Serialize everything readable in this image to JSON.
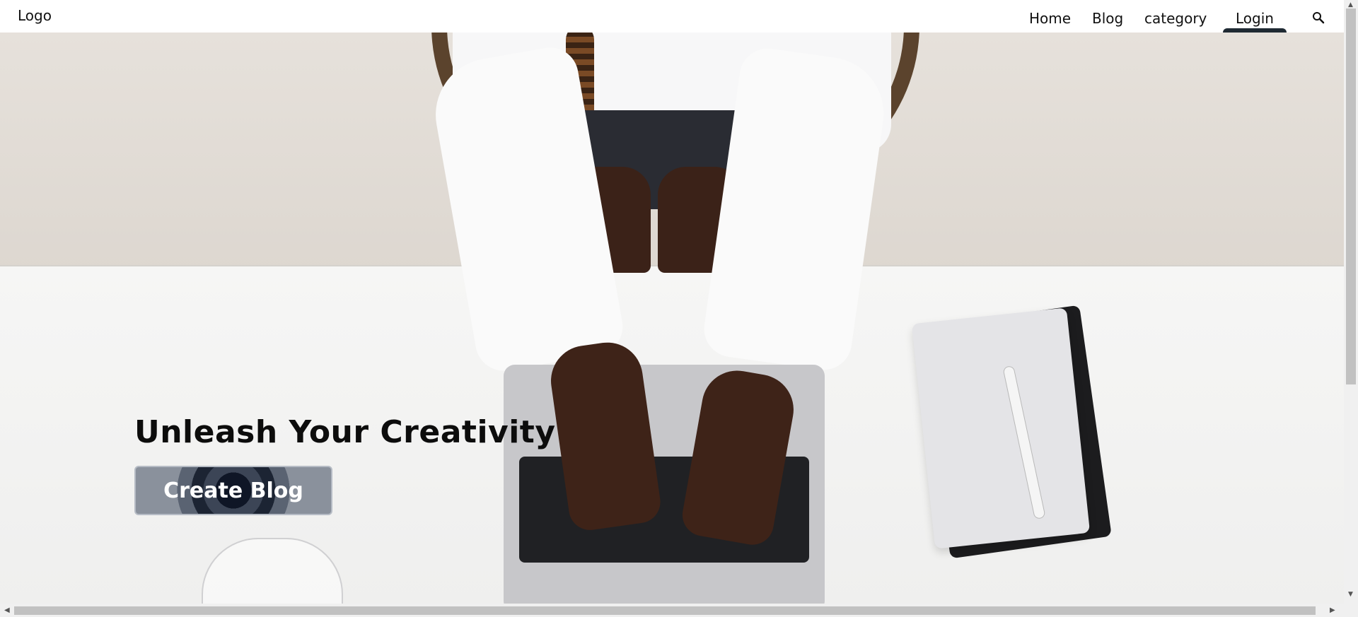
{
  "nav": {
    "logo": "Logo",
    "home": "Home",
    "blog": "Blog",
    "category": "category",
    "login": "Login",
    "search_icon": "search-icon"
  },
  "hero": {
    "title": "Unleash Your Creativity",
    "cta_label": "Create Blog"
  },
  "colors": {
    "nav_background": "#ffffff",
    "login_indicator": "#1f2a33",
    "title_text": "#0c0c0c",
    "cta_text": "#ffffff"
  },
  "scrollbars": {
    "vertical_up": "▲",
    "vertical_down": "▼",
    "horizontal_left": "◀",
    "horizontal_right": "▶"
  }
}
